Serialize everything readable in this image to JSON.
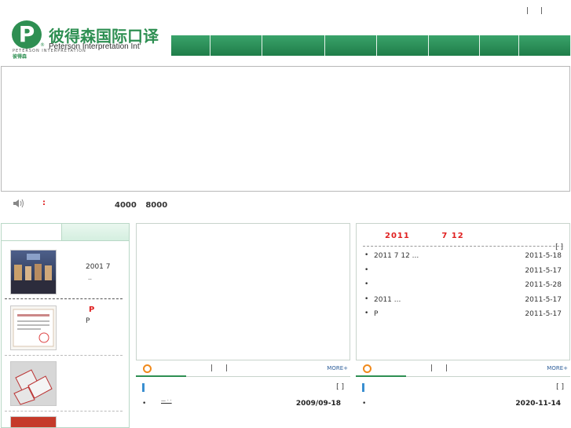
{
  "header": {
    "logo_letter": "P",
    "logo_reg": "®",
    "logo_cn": "彼得森国际口译",
    "logo_en": "Peterson Interpretation Int'",
    "logo_small_cn": "PETERSON INTERPRETATION",
    "logo_small_sub": "彼得森",
    "top_links": [
      "|",
      "|"
    ]
  },
  "nav": {
    "items": [
      "",
      "",
      "",
      "",
      "",
      "",
      "",
      ""
    ]
  },
  "notice": {
    "speaker_icon": "speaker-icon",
    "colon": ":",
    "hotline": [
      "4000",
      "8000"
    ]
  },
  "left": {
    "item1_text": [
      "2001 7",
      ".."
    ],
    "item2_red": "P",
    "item2_text": "P"
  },
  "news": {
    "title_parts": [
      "2011",
      "7 12"
    ],
    "more": "[ ]",
    "items": [
      {
        "title": "2011        7 12 ...",
        "date": "2011-5-18"
      },
      {
        "title": "",
        "date": "2011-5-17"
      },
      {
        "title": "",
        "date": "2011-5-28"
      },
      {
        "title": "2011                ...",
        "date": "2011-5-17"
      },
      {
        "title": "P",
        "date": "2011-5-17"
      }
    ]
  },
  "bottom_left": {
    "pipes": [
      "|",
      "|"
    ],
    "more": "MORE+",
    "brackets": "[ ]",
    "bullet": "•",
    "mid": "—  ·  ·",
    "date": "2009/09-18"
  },
  "bottom_right": {
    "pipes": [
      "|",
      "|"
    ],
    "more": "MORE+",
    "brackets": "[ ]",
    "bullet": "•",
    "date": "2020-11-14"
  },
  "colors": {
    "brand_green": "#2e8f52",
    "nav_green": "#1f7d49",
    "accent_red": "#e02020",
    "accent_orange": "#f08a1c"
  }
}
